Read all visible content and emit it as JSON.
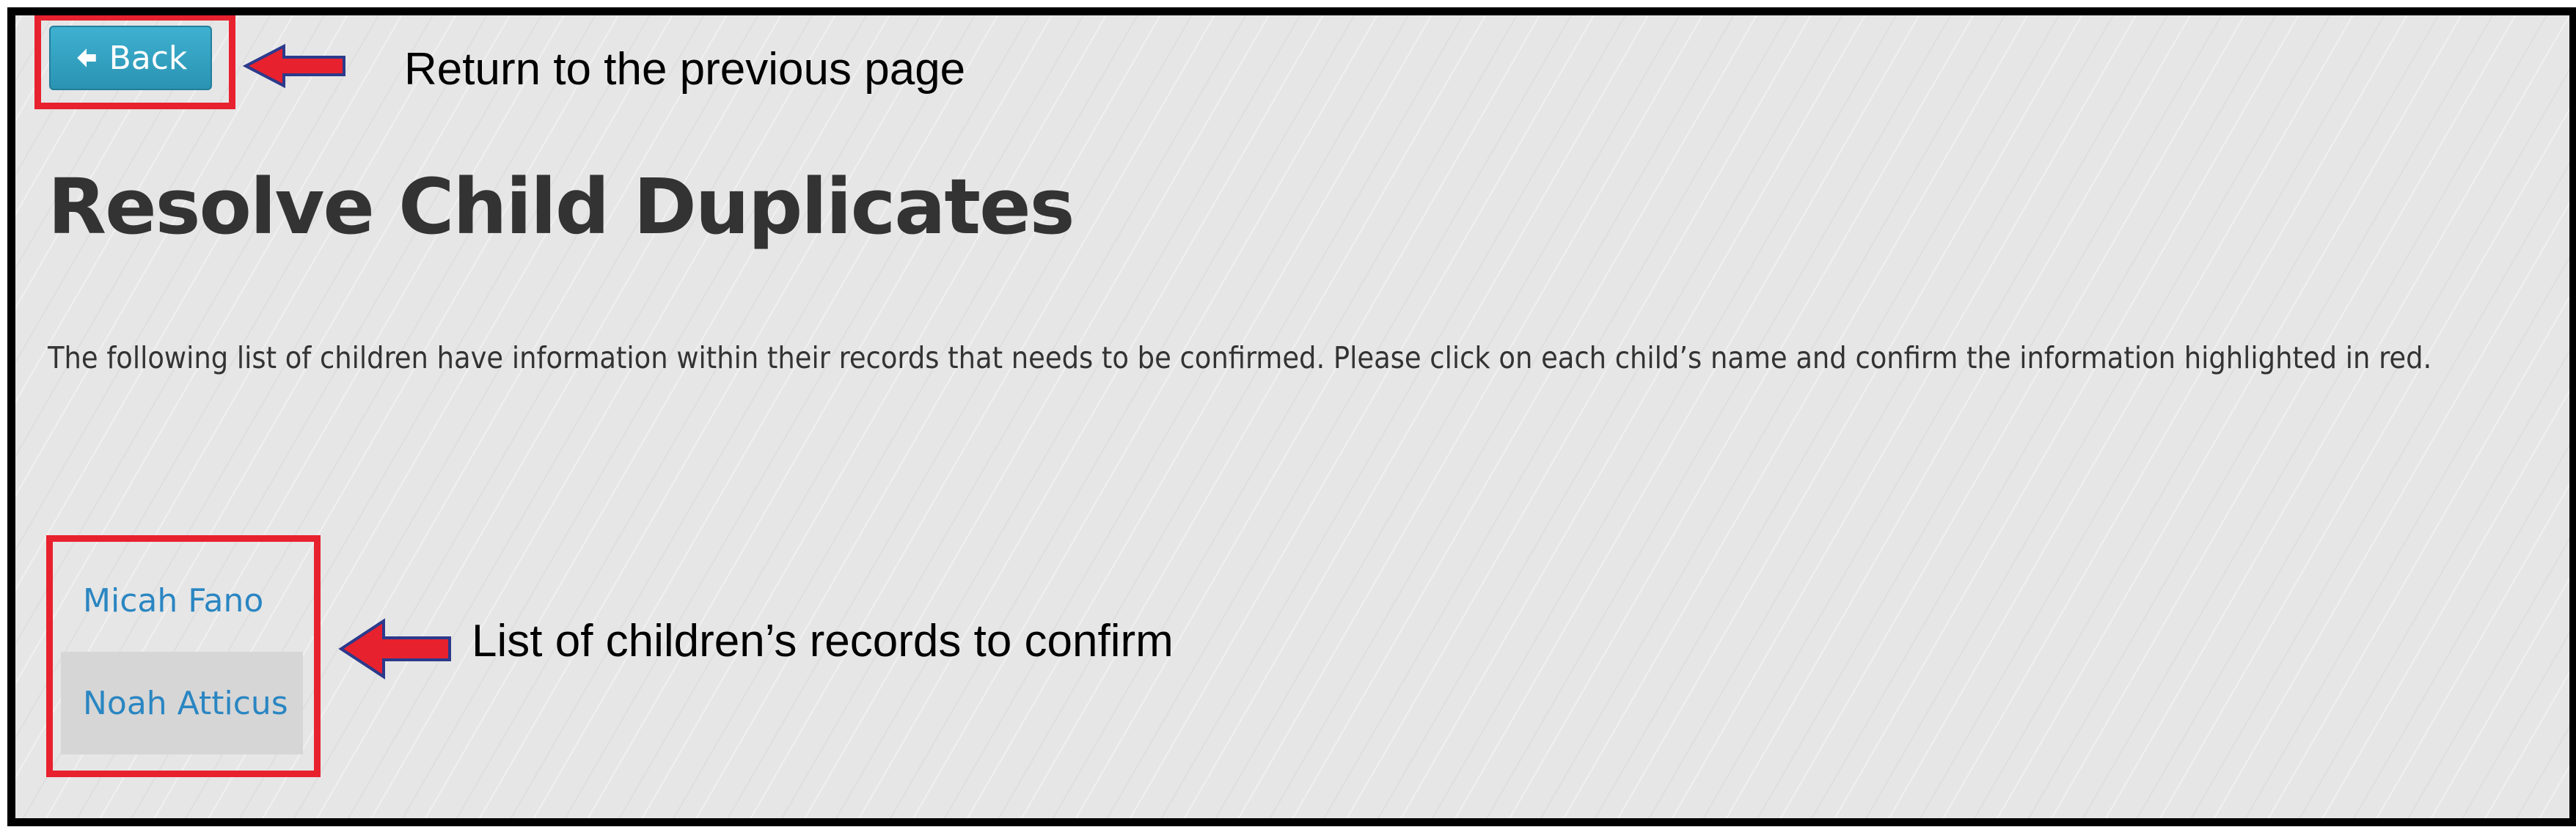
{
  "toolbar": {
    "back_label": "Back",
    "back_icon": "arrow-left-icon",
    "button_color": "#3fb1d0"
  },
  "annotations": {
    "back": "Return to the previous page",
    "list": "List of children’s records to confirm",
    "highlight_color": "#e8212e"
  },
  "main": {
    "title": "Resolve Child Duplicates",
    "instructions": "The following list of children have information within their records that needs to be confirmed. Please click on each child’s name and confirm the information highlighted in red."
  },
  "children": [
    {
      "name": "Micah Fano"
    },
    {
      "name": "Noah Atticus"
    }
  ]
}
